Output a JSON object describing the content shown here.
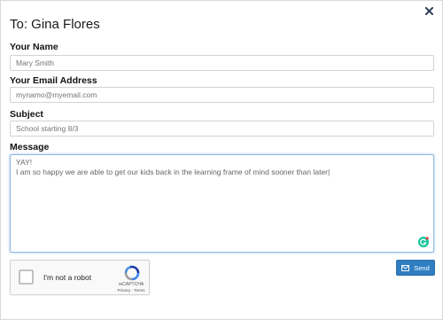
{
  "modal": {
    "title": "To: Gina Flores"
  },
  "form": {
    "name": {
      "label": "Your Name",
      "placeholder": "Mary Smith"
    },
    "email": {
      "label": "Your Email Address",
      "placeholder": "mynamo@myemail.com"
    },
    "subject": {
      "label": "Subject",
      "value": "School starting 8/3"
    },
    "message": {
      "label": "Message",
      "lines": [
        "YAY!",
        "I am so happy we are able to get our kids back in the learning frame of mind sooner than later|"
      ]
    }
  },
  "recaptcha": {
    "label": "I'm not a robot",
    "brand": "reCAPTCHA",
    "links": "Privacy - Terms"
  },
  "actions": {
    "send_label": "Send"
  },
  "colors": {
    "accent": "#2f7ec1",
    "focus_border": "#8fb9df",
    "grammarly": "#15c39a"
  },
  "icons": {
    "close": "close-icon",
    "send": "envelope-icon",
    "grammarly": "grammarly-icon",
    "recaptcha": "recaptcha-logo-icon"
  }
}
